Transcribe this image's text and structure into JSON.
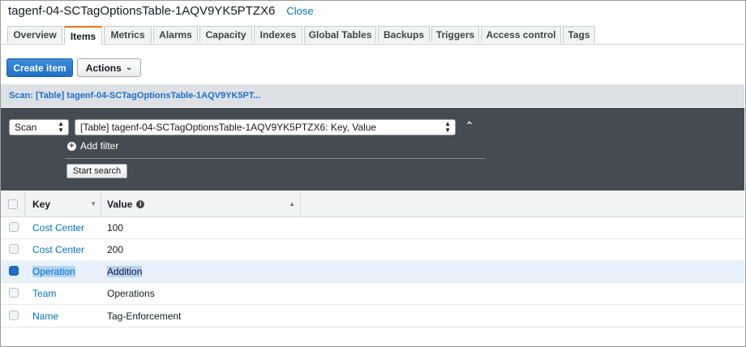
{
  "header": {
    "title": "tagenf-04-SCTagOptionsTable-1AQV9YK5PTZX6",
    "close_label": "Close"
  },
  "tabs": [
    {
      "label": "Overview"
    },
    {
      "label": "Items",
      "active": true
    },
    {
      "label": "Metrics"
    },
    {
      "label": "Alarms"
    },
    {
      "label": "Capacity"
    },
    {
      "label": "Indexes"
    },
    {
      "label": "Global Tables"
    },
    {
      "label": "Backups"
    },
    {
      "label": "Triggers"
    },
    {
      "label": "Access control"
    },
    {
      "label": "Tags"
    }
  ],
  "toolbar": {
    "create_item_label": "Create item",
    "actions_label": "Actions"
  },
  "scan_bar": {
    "label": "Scan: [Table] tagenf-04-SCTagOptionsTable-1AQV9YK5PT..."
  },
  "query": {
    "mode": "Scan",
    "target": "[Table] tagenf-04-SCTagOptionsTable-1AQV9YK5PTZX6: Key, Value",
    "add_filter_label": "Add filter",
    "start_search_label": "Start search"
  },
  "grid": {
    "columns": [
      "Key",
      "Value"
    ],
    "rows": [
      {
        "key": "Cost Center",
        "value": "100",
        "selected": false
      },
      {
        "key": "Cost Center",
        "value": "200",
        "selected": false
      },
      {
        "key": "Operation",
        "value": "Addition",
        "selected": true
      },
      {
        "key": "Team",
        "value": "Operations",
        "selected": false
      },
      {
        "key": "Name",
        "value": "Tag-Enforcement",
        "selected": false
      }
    ]
  },
  "colors": {
    "accent": "#ec7211",
    "primary": "#1f6fc7",
    "link": "#0073bb",
    "panel": "#444b52"
  }
}
